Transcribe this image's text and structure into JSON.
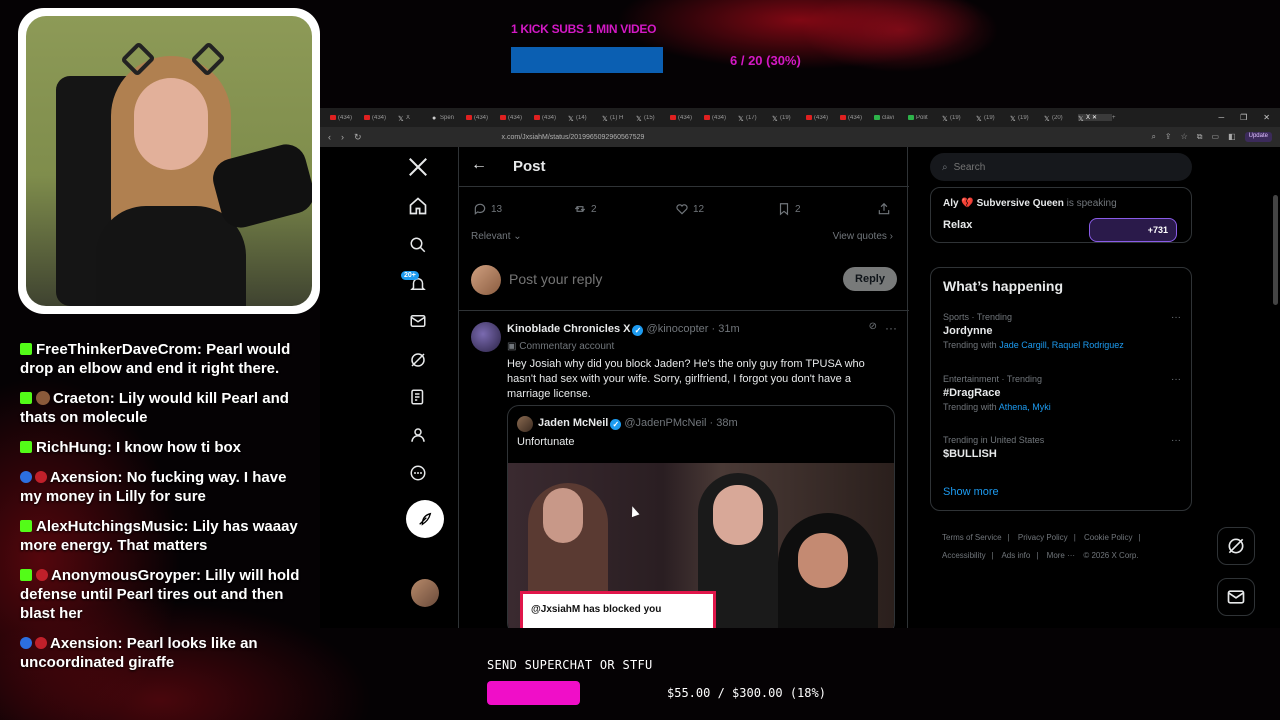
{
  "overlay": {
    "kick_goal_label": "1 KICK SUBS 1 MIN VIDEO",
    "kick_goal_count": "6 / 20 (30%)",
    "kick_goal_progress": 0.3,
    "superchat_label": "SEND SUPERCHAT OR STFU",
    "superchat_amount": "$55.00 / $300.00 (18%)",
    "superchat_progress": 0.18,
    "accent_color": "#d319c5",
    "superchat_color": "#f00ec8"
  },
  "chat": [
    {
      "user": "FreeThinkerDaveCrom",
      "text": "Pearl would drop an elbow and end it right there."
    },
    {
      "user": "Craeton",
      "text": "Lily would kill Pearl and thats on molecule"
    },
    {
      "user": "RichHung",
      "text": "I know how ti box"
    },
    {
      "user": "Axension",
      "text": "No fucking way. I have my money in Lilly for sure"
    },
    {
      "user": "AlexHutchingsMusic",
      "text": "Lily has waaay more energy. That matters"
    },
    {
      "user": "AnonymousGroyper",
      "text": "Lilly will hold defense until Pearl tires out and then blast her"
    },
    {
      "user": "Axension",
      "text": "Pearl looks like an uncoordinated giraffe"
    }
  ],
  "browser": {
    "url": "x.com/JxsiahM/status/2019965092960567529",
    "update_label": "Update",
    "tabs": [
      "(434)",
      "(434)",
      "X",
      "Spen",
      "(434)",
      "(434)",
      "(434)",
      "(14)",
      "(1) H",
      "(15)",
      "(434)",
      "(434)",
      "(17)",
      "(19)",
      "(434)",
      "(434)",
      "clavi",
      "Polit",
      "(19)",
      "(19)",
      "(19)",
      "(20)",
      "X"
    ]
  },
  "x": {
    "header_title": "Post",
    "nav_badge": "20+",
    "actions": {
      "replies": "13",
      "reposts": "2",
      "likes": "12",
      "bookmarks": "2"
    },
    "sort_label": "Relevant",
    "view_quotes": "View quotes",
    "reply_placeholder": "Post your reply",
    "reply_button": "Reply",
    "tweet": {
      "name": "Kinoblade Chronicles X",
      "handle": "@kinocopter · 31m",
      "label": "Commentary account",
      "text": "Hey Josiah why did you block Jaden? He's the only guy from TPUSA who hasn't had sex with your wife. Sorry, girlfriend, I forgot you don't have a marriage license."
    },
    "quote": {
      "name": "Jaden McNeil",
      "handle": "@JadenPMcNeil · 38m",
      "text": "Unfortunate",
      "media_caption": "@JxsiahM has blocked you"
    },
    "search_placeholder": "Search",
    "space": {
      "host": "Aly 💔 Subversive Queen",
      "status": "is speaking",
      "title": "Relax",
      "listeners": "+731"
    },
    "trends_title": "What’s happening",
    "trends": [
      {
        "category": "Sports · Trending",
        "name": "Jordynne",
        "with_label": "Trending with",
        "with": "Jade Cargill, Raquel Rodriguez"
      },
      {
        "category": "Entertainment · Trending",
        "name": "#DragRace",
        "with_label": "Trending with",
        "with": "Athena, Myki"
      },
      {
        "category": "Trending in United States",
        "name": "$BULLISH",
        "with_label": "",
        "with": ""
      }
    ],
    "show_more": "Show more",
    "footer": [
      "Terms of Service",
      "|",
      "Privacy Policy",
      "|",
      "Cookie Policy",
      "|",
      "Accessibility",
      "|",
      "Ads info",
      "|",
      "More ···",
      "© 2026 X Corp."
    ]
  }
}
